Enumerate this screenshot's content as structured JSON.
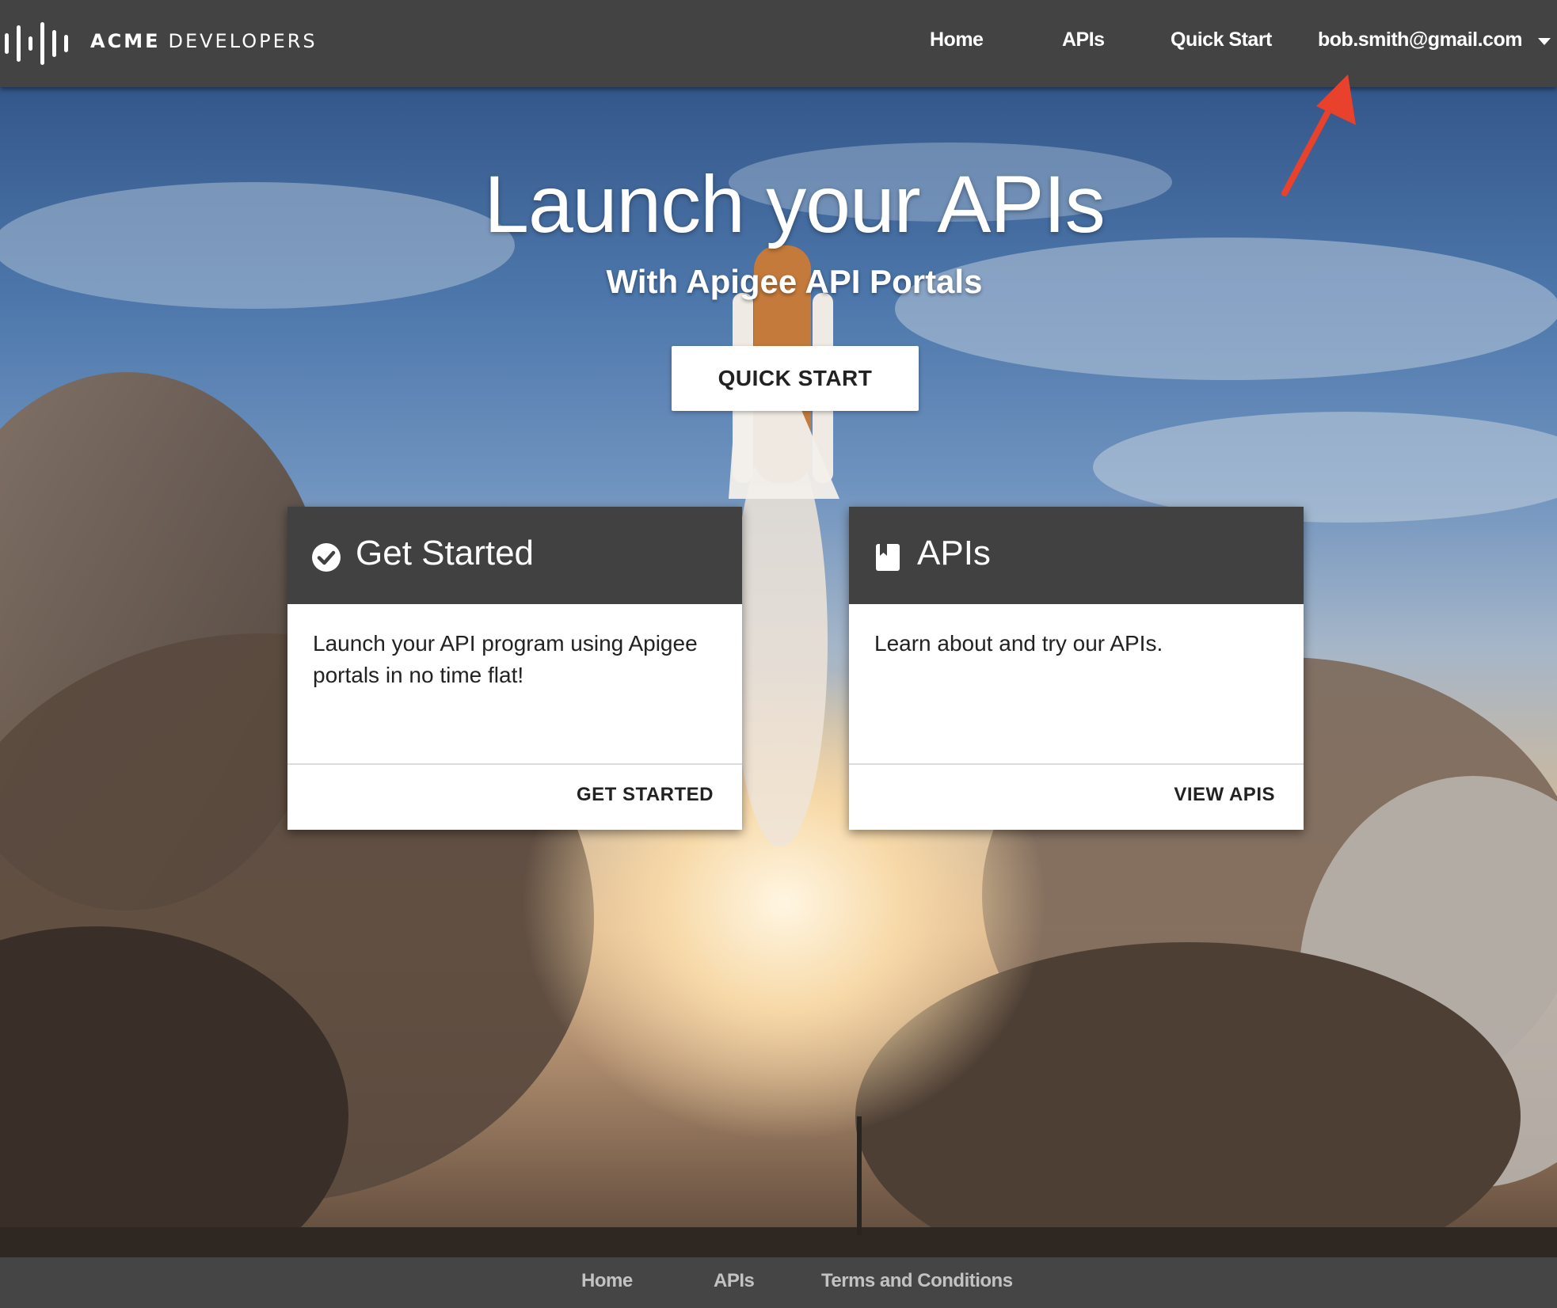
{
  "header": {
    "brand_primary": "ACME",
    "brand_secondary": "DEVELOPERS",
    "nav": [
      {
        "label": "Home"
      },
      {
        "label": "APIs"
      },
      {
        "label": "Quick Start"
      }
    ],
    "user_email": "bob.smith@gmail.com"
  },
  "hero": {
    "title": "Launch your APIs",
    "subtitle": "With Apigee API Portals",
    "cta_label": "QUICK START"
  },
  "cards": [
    {
      "icon": "check-circle-icon",
      "title": "Get Started",
      "body": "Launch your API program using Apigee portals in no time flat!",
      "action": "GET STARTED"
    },
    {
      "icon": "book-icon",
      "title": "APIs",
      "body": "Learn about and try our APIs.",
      "action": "VIEW APIS"
    }
  ],
  "footer": {
    "links": [
      {
        "label": "Home"
      },
      {
        "label": "APIs"
      },
      {
        "label": "Terms and Conditions"
      }
    ]
  },
  "colors": {
    "header_bg": "#434343",
    "card_header_bg": "#414141",
    "annotation_arrow": "#e8412c"
  }
}
